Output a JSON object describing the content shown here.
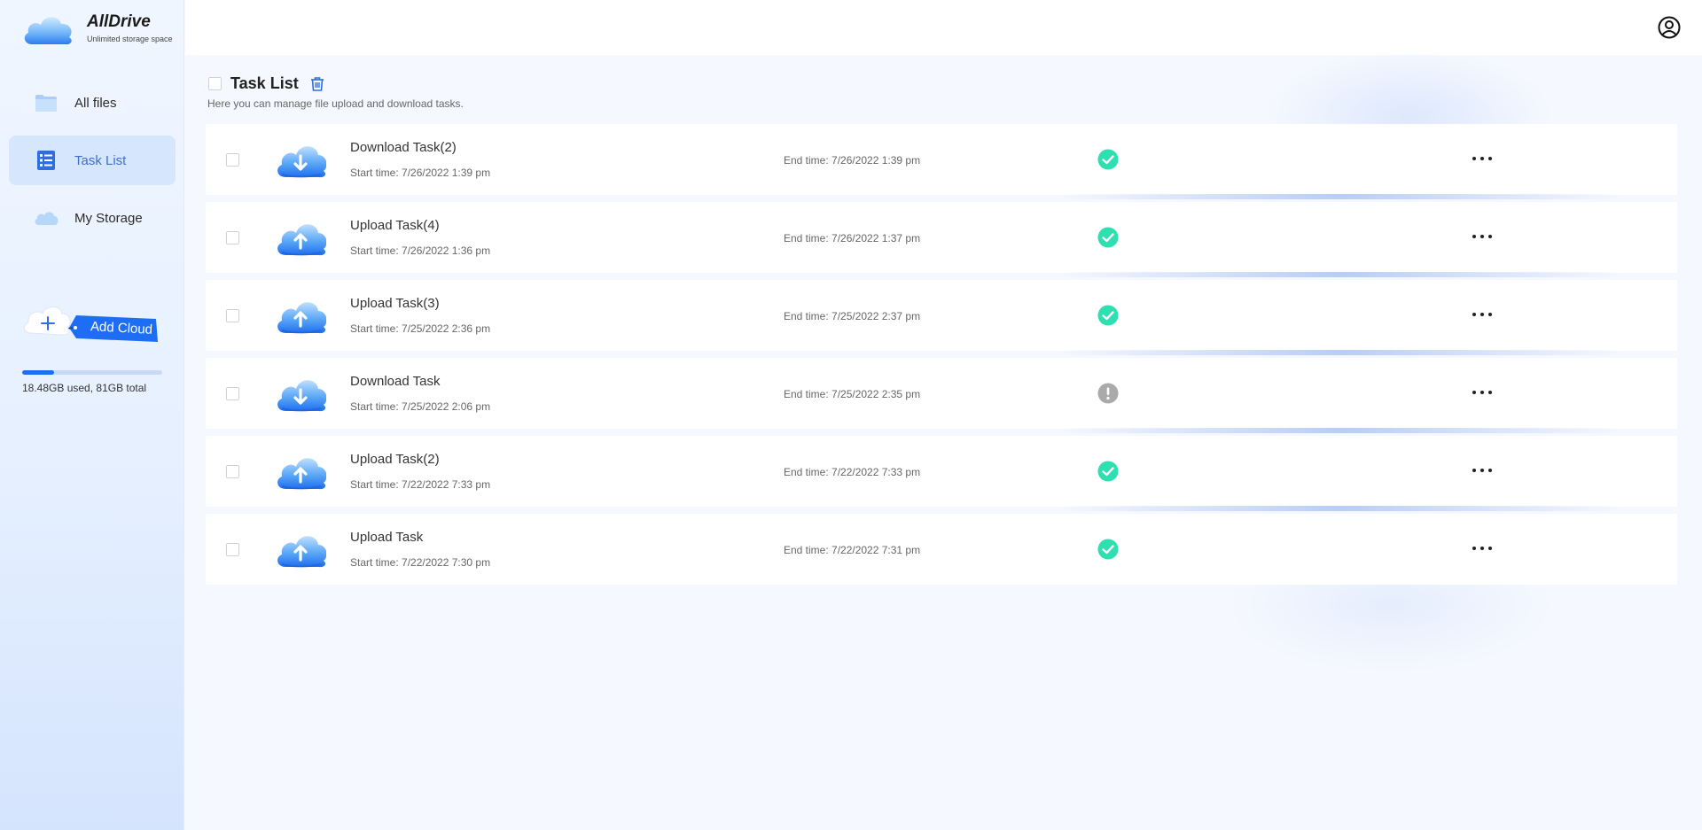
{
  "app": {
    "name": "AllDrive",
    "tagline": "Unlimited storage space"
  },
  "sidebar": {
    "items": [
      {
        "label": "All files",
        "icon": "folder-icon",
        "active": false
      },
      {
        "label": "Task List",
        "icon": "task-list-icon",
        "active": true
      },
      {
        "label": "My Storage",
        "icon": "cloud-storage-icon",
        "active": false
      }
    ],
    "add_cloud_label": "Add Cloud",
    "storage": {
      "used_fraction": 0.228,
      "text": "18.48GB used, 81GB total"
    }
  },
  "header": {
    "user_icon": "user-avatar-icon"
  },
  "main": {
    "title": "Task List",
    "subtitle": "Here you can manage file upload and download tasks.",
    "tasks": [
      {
        "name": "Download Task(2)",
        "type": "download",
        "start": "Start time: 7/26/2022 1:39 pm",
        "end": "End time: 7/26/2022 1:39 pm",
        "status": "success"
      },
      {
        "name": "Upload Task(4)",
        "type": "upload",
        "start": "Start time: 7/26/2022 1:36 pm",
        "end": "End time: 7/26/2022 1:37 pm",
        "status": "success"
      },
      {
        "name": "Upload Task(3)",
        "type": "upload",
        "start": "Start time: 7/25/2022 2:36 pm",
        "end": "End time: 7/25/2022 2:37 pm",
        "status": "success"
      },
      {
        "name": "Download Task",
        "type": "download",
        "start": "Start time: 7/25/2022 2:06 pm",
        "end": "End time: 7/25/2022 2:35 pm",
        "status": "warning"
      },
      {
        "name": "Upload Task(2)",
        "type": "upload",
        "start": "Start time: 7/22/2022 7:33 pm",
        "end": "End time: 7/22/2022 7:33 pm",
        "status": "success"
      },
      {
        "name": "Upload Task",
        "type": "upload",
        "start": "Start time: 7/22/2022 7:30 pm",
        "end": "End time: 7/22/2022 7:31 pm",
        "status": "success"
      }
    ]
  },
  "colors": {
    "accent": "#1e6ef5",
    "success": "#2ee0b0",
    "warning": "#aaaaaa",
    "active_nav_bg": "#d6e6fd"
  }
}
